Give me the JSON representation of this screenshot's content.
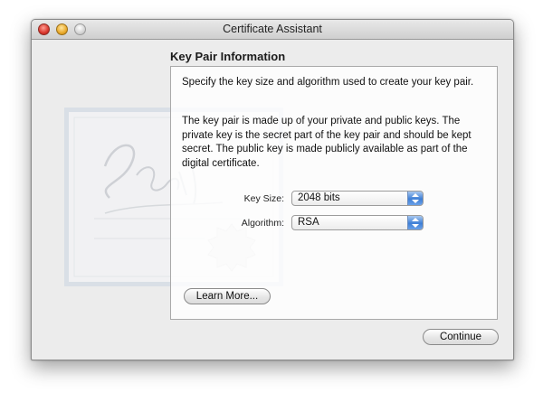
{
  "window": {
    "title": "Certificate Assistant"
  },
  "section": {
    "title": "Key Pair Information"
  },
  "content": {
    "paragraph1": "Specify the key size and algorithm used to create your key pair.",
    "paragraph2": "The key pair is made up of your private and public keys. The private key is the secret part of the key pair and should be kept secret. The public key is made publicly available as part of the digital certificate."
  },
  "form": {
    "key_size_label": "Key Size:",
    "key_size_value": "2048 bits",
    "algorithm_label": "Algorithm:",
    "algorithm_value": "RSA"
  },
  "buttons": {
    "learn_more": "Learn More...",
    "continue": "Continue"
  },
  "icons": {
    "close": "close-button-icon",
    "minimize": "minimize-button-icon",
    "zoom": "zoom-button-icon",
    "background": "certificate-watermark-icon",
    "stepper": "up-down-stepper-icon"
  },
  "colors": {
    "accent": "#3f7fd6",
    "window_bg": "#ececec"
  }
}
